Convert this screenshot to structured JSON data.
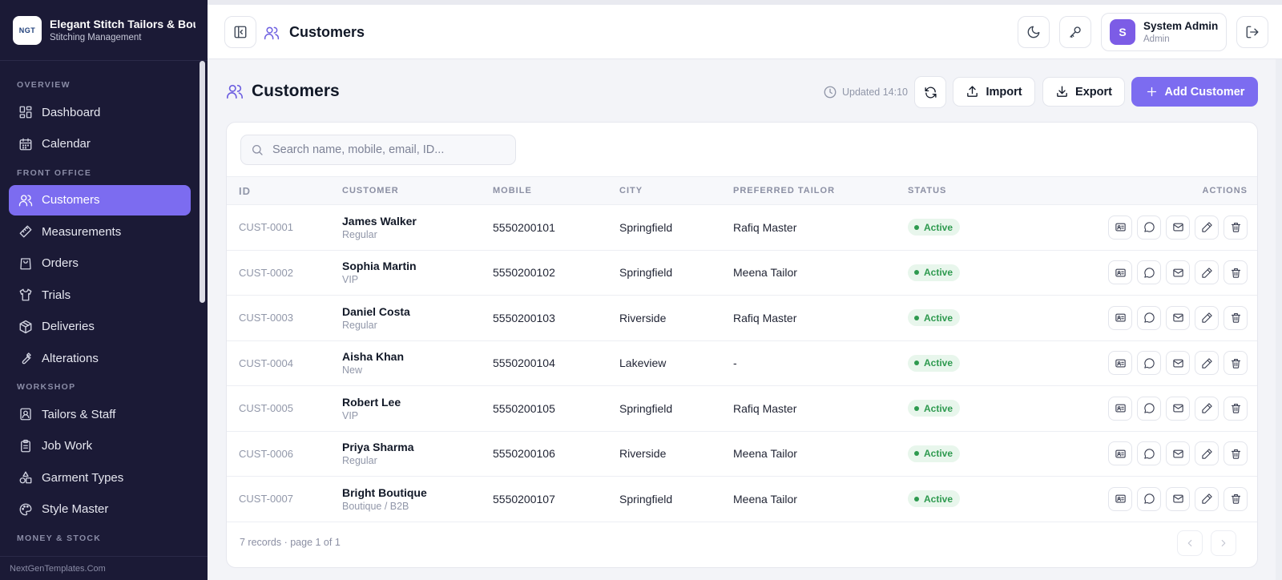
{
  "brand": {
    "logo_text": "NGT",
    "name": "Elegant Stitch Tailors & Boutique",
    "subtitle": "Stitching Management"
  },
  "sidebar": {
    "sections": [
      {
        "title": "OVERVIEW",
        "items": [
          {
            "label": "Dashboard",
            "icon": "dashboard-icon"
          },
          {
            "label": "Calendar",
            "icon": "calendar-icon"
          }
        ]
      },
      {
        "title": "FRONT OFFICE",
        "items": [
          {
            "label": "Customers",
            "icon": "users-icon",
            "active": true
          },
          {
            "label": "Measurements",
            "icon": "ruler-icon"
          },
          {
            "label": "Orders",
            "icon": "bag-icon"
          },
          {
            "label": "Trials",
            "icon": "shirt-icon"
          },
          {
            "label": "Deliveries",
            "icon": "package-icon"
          },
          {
            "label": "Alterations",
            "icon": "wrench-icon"
          }
        ]
      },
      {
        "title": "WORKSHOP",
        "items": [
          {
            "label": "Tailors & Staff",
            "icon": "staff-icon"
          },
          {
            "label": "Job Work",
            "icon": "clipboard-icon"
          },
          {
            "label": "Garment Types",
            "icon": "shapes-icon"
          },
          {
            "label": "Style Master",
            "icon": "palette-icon"
          }
        ]
      },
      {
        "title": "MONEY & STOCK",
        "items": []
      }
    ],
    "footer": "NextGenTemplates.Com"
  },
  "topbar": {
    "title": "Customers",
    "user": {
      "initial": "S",
      "name": "System Admin",
      "role": "Admin"
    }
  },
  "page": {
    "title": "Customers",
    "updated": "Updated 14:10",
    "import_label": "Import",
    "export_label": "Export",
    "add_label": "Add Customer"
  },
  "search": {
    "placeholder": "Search name, mobile, email, ID..."
  },
  "table": {
    "headers": {
      "id": "ID",
      "customer": "CUSTOMER",
      "mobile": "MOBILE",
      "city": "CITY",
      "tailor": "PREFERRED TAILOR",
      "status": "STATUS",
      "actions": "ACTIONS"
    },
    "rows": [
      {
        "id": "CUST-0001",
        "name": "James Walker",
        "type": "Regular",
        "mobile": "5550200101",
        "city": "Springfield",
        "tailor": "Rafiq Master",
        "status": "Active"
      },
      {
        "id": "CUST-0002",
        "name": "Sophia Martin",
        "type": "VIP",
        "mobile": "5550200102",
        "city": "Springfield",
        "tailor": "Meena Tailor",
        "status": "Active"
      },
      {
        "id": "CUST-0003",
        "name": "Daniel Costa",
        "type": "Regular",
        "mobile": "5550200103",
        "city": "Riverside",
        "tailor": "Rafiq Master",
        "status": "Active"
      },
      {
        "id": "CUST-0004",
        "name": "Aisha Khan",
        "type": "New",
        "mobile": "5550200104",
        "city": "Lakeview",
        "tailor": "-",
        "status": "Active"
      },
      {
        "id": "CUST-0005",
        "name": "Robert Lee",
        "type": "VIP",
        "mobile": "5550200105",
        "city": "Springfield",
        "tailor": "Rafiq Master",
        "status": "Active"
      },
      {
        "id": "CUST-0006",
        "name": "Priya Sharma",
        "type": "Regular",
        "mobile": "5550200106",
        "city": "Riverside",
        "tailor": "Meena Tailor",
        "status": "Active"
      },
      {
        "id": "CUST-0007",
        "name": "Bright Boutique",
        "type": "Boutique / B2B",
        "mobile": "5550200107",
        "city": "Springfield",
        "tailor": "Meena Tailor",
        "status": "Active"
      }
    ]
  },
  "footer": {
    "records": "7 records · page 1 of 1"
  },
  "colors": {
    "accent": "#7c6cf0",
    "sidebar_bg": "#1b1a36",
    "active_green": "#2e9a4f"
  }
}
